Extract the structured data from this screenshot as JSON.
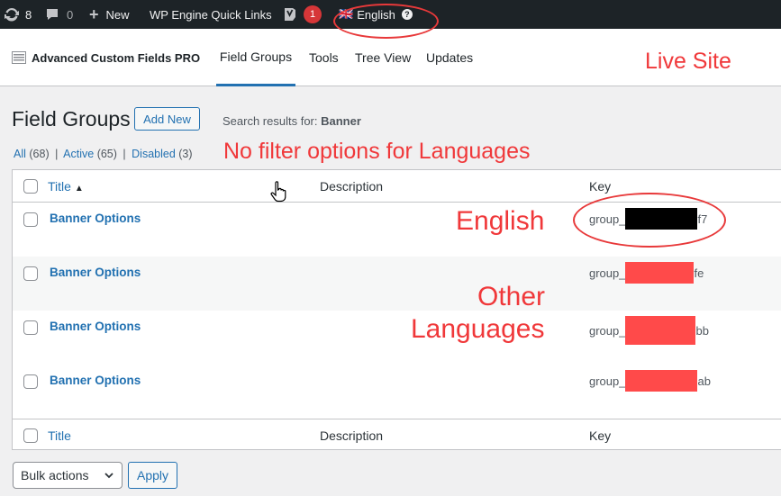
{
  "adminbar": {
    "updates_count": "8",
    "comments_count": "0",
    "new_label": "New",
    "quick_links_label": "WP Engine Quick Links",
    "yoast_badge": "1",
    "language_label": "English",
    "language_flag": "🇬🇧"
  },
  "acf": {
    "brand": "Advanced Custom Fields PRO",
    "tabs": [
      {
        "label": "Field Groups"
      },
      {
        "label": "Tools"
      },
      {
        "label": "Tree View"
      },
      {
        "label": "Updates"
      }
    ]
  },
  "page": {
    "title": "Field Groups",
    "add_new": "Add New",
    "search_prefix": "Search results for: ",
    "search_term": "Banner"
  },
  "filters": {
    "all": "All",
    "all_count": "(68)",
    "active": "Active",
    "active_count": "(65)",
    "disabled": "Disabled",
    "disabled_count": "(3)",
    "sep": "|"
  },
  "table": {
    "columns": {
      "title": "Title",
      "title_sort": "▲",
      "description": "Description",
      "key": "Key"
    },
    "rows": [
      {
        "title": "Banner Options",
        "key_prefix": "group_",
        "key_suffix": "f7",
        "redact_color": "#000000"
      },
      {
        "title": "Banner Options",
        "key_prefix": "group_",
        "key_suffix": "fe",
        "redact_color": "#ff4a4a"
      },
      {
        "title": "Banner Options",
        "key_prefix": "group_",
        "key_suffix": "bb",
        "redact_color": "#ff4a4a"
      },
      {
        "title": "Banner Options",
        "key_prefix": "group_",
        "key_suffix": "ab",
        "redact_color": "#ff4a4a"
      }
    ]
  },
  "bulk": {
    "label": "Bulk actions",
    "apply": "Apply"
  },
  "annotations": {
    "live_site": "Live Site",
    "no_filter": "No filter options for Languages",
    "english": "English",
    "other_1": "Other",
    "other_2": "Languages"
  },
  "colors": {
    "accent": "#2271b1",
    "annotation": "#f0383a",
    "adminbar": "#1d2327"
  }
}
